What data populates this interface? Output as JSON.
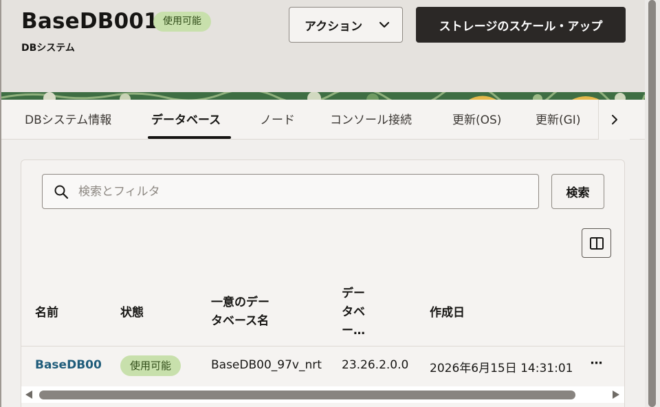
{
  "header": {
    "title": "BaseDB001",
    "status": "使用可能",
    "subtitle": "DBシステム",
    "actions_label": "アクション",
    "scale_label": "ストレージのスケール・アップ"
  },
  "tabs": [
    {
      "label": "DBシステム情報"
    },
    {
      "label": "データベース"
    },
    {
      "label": "ノード"
    },
    {
      "label": "コンソール接続"
    },
    {
      "label": "更新(OS)"
    },
    {
      "label": "更新(GI)"
    }
  ],
  "active_tab": "データベース",
  "search": {
    "placeholder": "検索とフィルタ",
    "value": "",
    "button_label": "検索"
  },
  "table": {
    "columns": [
      {
        "line1": "名前",
        "line2": "",
        "line3": ""
      },
      {
        "line1": "状態",
        "line2": "",
        "line3": ""
      },
      {
        "line1": "一意のデー",
        "line2": "タベース名",
        "line3": ""
      },
      {
        "line1": "デー",
        "line2": "タベ",
        "line3": "ー…"
      },
      {
        "line1": "作成日",
        "line2": "",
        "line3": ""
      }
    ],
    "rows": [
      {
        "name": "BaseDB00",
        "status": "使用可能",
        "unique_name": "BaseDB00_97v_nrt",
        "version": "23.26.2.0.0",
        "created": "2026年6月15日 14:31:01",
        "more": "⋯"
      }
    ]
  },
  "colors": {
    "status_badge": "#c8e0ac",
    "primary_button": "#2b2826",
    "link": "#1f5c7a"
  },
  "icons": {
    "actions": "chevron-down-icon",
    "tabs_next": "chevron-right-icon",
    "search": "search-icon",
    "columns": "columns-icon",
    "row_menu": "more-horizontal-icon"
  }
}
